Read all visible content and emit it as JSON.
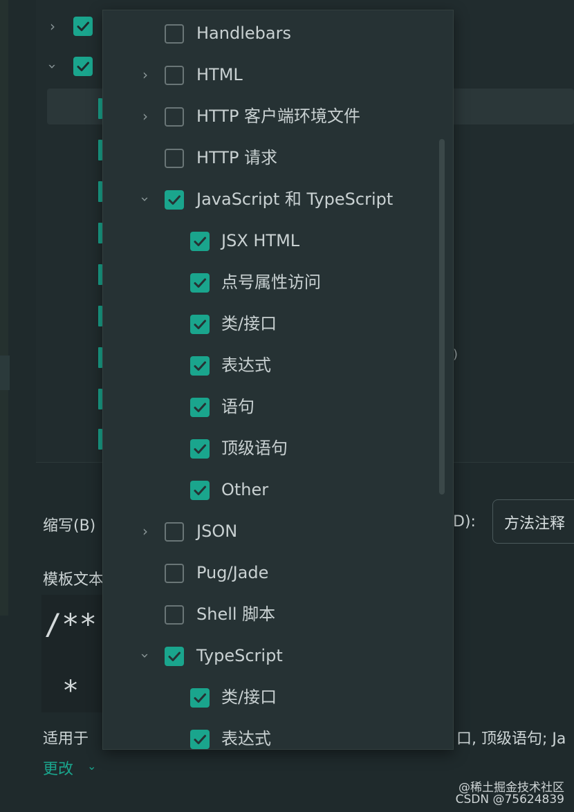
{
  "colors": {
    "accent": "#1aa58d",
    "background": "#1f2a2c",
    "popup": "#263234",
    "text": "#c9d1d2"
  },
  "background_dialog": {
    "abbrev_label": "缩写(B)",
    "desc_label_suffix": "D):",
    "description_value": "方法注释",
    "template_text_label": "模板文本",
    "code_lines": [
      "/**",
      "*"
    ],
    "applicable_label": "适用于",
    "applicable_value": "口, 顶级语句; Ja",
    "change_link": "更改",
    "stray_mark": ")"
  },
  "dropdown": {
    "items": [
      {
        "label": "Handlebars",
        "checked": false,
        "expander": "none",
        "level": 0
      },
      {
        "label": "HTML",
        "checked": false,
        "expander": "collapsed",
        "level": 0
      },
      {
        "label": "HTTP 客户端环境文件",
        "checked": false,
        "expander": "collapsed",
        "level": 0
      },
      {
        "label": "HTTP 请求",
        "checked": false,
        "expander": "none",
        "level": 0
      },
      {
        "label": "JavaScript 和 TypeScript",
        "checked": true,
        "expander": "expanded",
        "level": 0
      },
      {
        "label": "JSX HTML",
        "checked": true,
        "expander": "none",
        "level": 1
      },
      {
        "label": "点号属性访问",
        "checked": true,
        "expander": "none",
        "level": 1
      },
      {
        "label": "类/接口",
        "checked": true,
        "expander": "none",
        "level": 1
      },
      {
        "label": "表达式",
        "checked": true,
        "expander": "none",
        "level": 1
      },
      {
        "label": "语句",
        "checked": true,
        "expander": "none",
        "level": 1
      },
      {
        "label": "顶级语句",
        "checked": true,
        "expander": "none",
        "level": 1
      },
      {
        "label": "Other",
        "checked": true,
        "expander": "none",
        "level": 1
      },
      {
        "label": "JSON",
        "checked": false,
        "expander": "collapsed",
        "level": 0
      },
      {
        "label": "Pug/Jade",
        "checked": false,
        "expander": "none",
        "level": 0
      },
      {
        "label": "Shell 脚本",
        "checked": false,
        "expander": "none",
        "level": 0
      },
      {
        "label": "TypeScript",
        "checked": true,
        "expander": "expanded",
        "level": 0
      },
      {
        "label": "类/接口",
        "checked": true,
        "expander": "none",
        "level": 1
      },
      {
        "label": "表达式",
        "checked": true,
        "expander": "none",
        "level": 1
      }
    ]
  },
  "watermark": {
    "line1": "@稀土掘金技术社区",
    "line2": "CSDN @75624839"
  }
}
